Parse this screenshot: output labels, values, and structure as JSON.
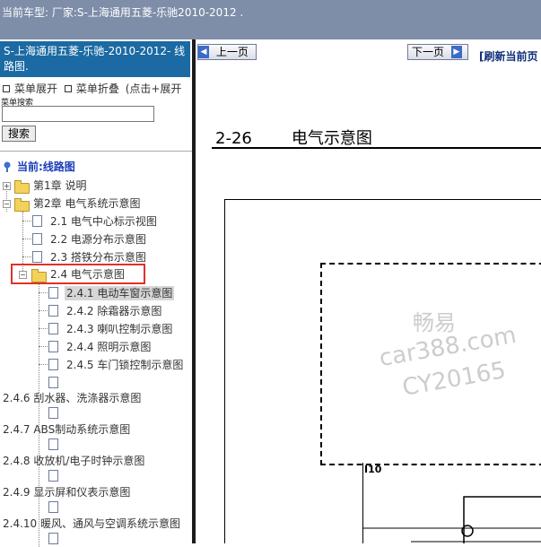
{
  "topbar": {
    "text": "当前车型:  厂家:S-上海通用五菱-乐驰2010-2012 ."
  },
  "sidebar": {
    "title": "S-上海通用五菱-乐驰-2010-2012- 线路图.",
    "menu_expand": "菜单展开",
    "menu_collapse": "菜单折叠",
    "menu_hint": "(点击+展开",
    "search_label": "菜单搜索",
    "search_button": "搜索",
    "current_label": "当前:线路图",
    "tree": [
      {
        "label": "第1章 说明"
      },
      {
        "label": "第2章 电气系统示意图"
      },
      {
        "label": "2.1 电气中心标示视图"
      },
      {
        "label": "2.2 电源分布示意图"
      },
      {
        "label": "2.3 搭铁分布示意图"
      },
      {
        "label": "2.4 电气示意图"
      },
      {
        "label": "2.4.1 电动车窗示意图"
      },
      {
        "label": "2.4.2 除霜器示意图"
      },
      {
        "label": "2.4.3 喇叭控制示意图"
      },
      {
        "label": "2.4.4 照明示意图"
      },
      {
        "label": "2.4.5 车门锁控制示意图"
      },
      {
        "label": "2.4.6 刮水器、洗涤器示意图"
      },
      {
        "label": "2.4.7 ABS制动系统示意图"
      },
      {
        "label": "2.4.8 收放机/电子时钟示意图"
      },
      {
        "label": "2.4.9 显示屏和仪表示意图"
      },
      {
        "label": "2.4.10 暖风、通风与空调系统示意图"
      }
    ]
  },
  "content": {
    "prev_label": "上一页",
    "next_label": "下一页",
    "refresh_label": "[刷新当前页",
    "page_number": "2-26",
    "page_title": "电气示意图",
    "connector_label": "I10",
    "watermark": [
      "畅易",
      "car388.com",
      "CY20165"
    ]
  }
}
